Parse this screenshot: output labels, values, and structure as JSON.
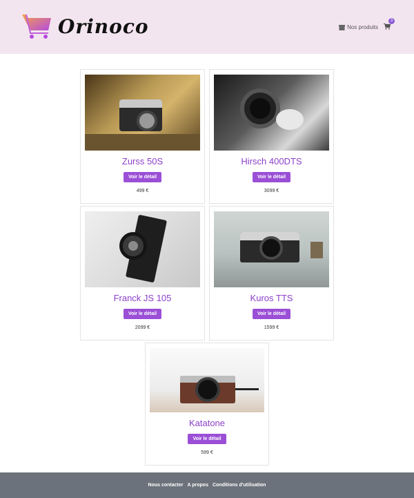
{
  "brand": {
    "name": "Orinoco"
  },
  "nav": {
    "products_label": "Nos produits",
    "cart_count": "3"
  },
  "colors": {
    "accent": "#9a4fd6",
    "header_bg": "#f3e5ef",
    "footer_bg": "#6c727b"
  },
  "products": [
    {
      "name": "Zurss 50S",
      "button": "Voir le détail",
      "price": "499 €"
    },
    {
      "name": "Hirsch 400DTS",
      "button": "Voir le détail",
      "price": "3099 €"
    },
    {
      "name": "Franck JS 105",
      "button": "Voir le détail",
      "price": "2099 €"
    },
    {
      "name": "Kuros TTS",
      "button": "Voir le détail",
      "price": "1599 €"
    },
    {
      "name": "Katatone",
      "button": "Voir le détail",
      "price": "599 €"
    }
  ],
  "footer": {
    "links": [
      "Nous contacter",
      "A propos",
      "Conditions d'utilisation"
    ]
  }
}
